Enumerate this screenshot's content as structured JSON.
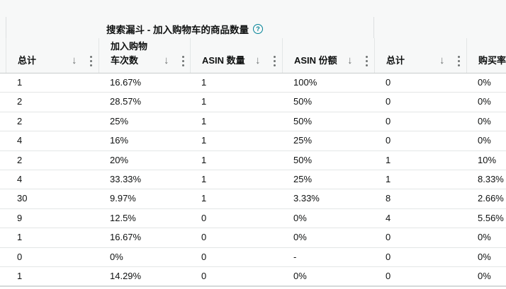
{
  "group": {
    "title": "搜索漏斗 - 加入购物车的商品数量",
    "help_icon": "question-circle-icon"
  },
  "columns": [
    {
      "label": "总计"
    },
    {
      "label": "加入购物\n车次数"
    },
    {
      "label": "ASIN 数量"
    },
    {
      "label": "ASIN 份额"
    },
    {
      "label": "总计"
    },
    {
      "label": "购买率"
    }
  ],
  "rows": [
    [
      "1",
      "16.67%",
      "1",
      "100%",
      "0",
      "0%"
    ],
    [
      "2",
      "28.57%",
      "1",
      "50%",
      "0",
      "0%"
    ],
    [
      "2",
      "25%",
      "1",
      "50%",
      "0",
      "0%"
    ],
    [
      "4",
      "16%",
      "1",
      "25%",
      "0",
      "0%"
    ],
    [
      "2",
      "20%",
      "1",
      "50%",
      "1",
      "10%"
    ],
    [
      "4",
      "33.33%",
      "1",
      "25%",
      "1",
      "8.33%"
    ],
    [
      "30",
      "9.97%",
      "1",
      "3.33%",
      "8",
      "2.66%"
    ],
    [
      "9",
      "12.5%",
      "0",
      "0%",
      "4",
      "5.56%"
    ],
    [
      "1",
      "16.67%",
      "0",
      "0%",
      "0",
      "0%"
    ],
    [
      "0",
      "0%",
      "0",
      "-",
      "0",
      "0%"
    ],
    [
      "1",
      "14.29%",
      "0",
      "0%",
      "0",
      "0%"
    ]
  ],
  "colors": {
    "header_bg": "#f7f8f8",
    "border": "#e3e6e6",
    "help_icon": "#008296",
    "icon_gray": "#6f7373"
  }
}
